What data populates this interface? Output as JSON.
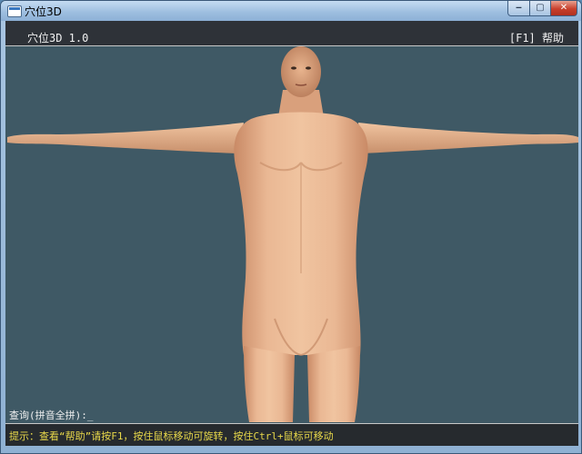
{
  "window": {
    "title": "穴位3D",
    "controls": {
      "minimize": "‒",
      "maximize": "▢",
      "close": "✕"
    }
  },
  "header": {
    "version": "穴位3D 1.0",
    "help": "[F1] 帮助"
  },
  "query": {
    "label": "查询(拼音全拼):",
    "value": "_"
  },
  "status": {
    "hint": "提示：查看“帮助”请按F1，按住鼠标移动可旋转，按住Ctrl+鼠标可移动"
  },
  "colors": {
    "background": "#3f5965",
    "skin": "#e9b48f",
    "hint_text": "#e8d84a"
  }
}
